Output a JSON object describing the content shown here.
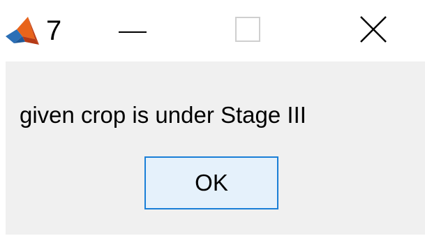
{
  "window": {
    "title": "7",
    "app_icon": "matlab-icon",
    "controls": {
      "minimize_icon": "minimize-icon",
      "maximize_icon": "maximize-icon",
      "close_icon": "close-icon"
    }
  },
  "dialog": {
    "message": "given crop is under Stage III",
    "ok_label": "OK"
  },
  "colors": {
    "titlebar_bg": "#ffffff",
    "content_bg": "#f0f0f0",
    "button_border": "#1a7fd7",
    "button_bg": "#e5f1fb"
  }
}
